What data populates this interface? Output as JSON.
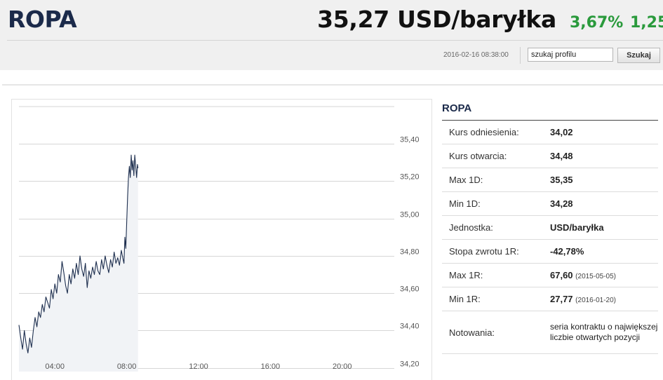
{
  "header": {
    "title": "ROPA",
    "price": "35,27 USD/baryłka",
    "change_pct": "3,67%",
    "change_abs": "1,25",
    "timestamp": "2016-02-16 08:38:00",
    "search": {
      "value": "szukaj profilu",
      "placeholder": "szukaj profilu",
      "button_label": "Szukaj"
    }
  },
  "colors": {
    "positive": "#2a9a3c",
    "title": "#1b2a4a",
    "line": "#1e2f4f",
    "area": "#f1f3f6"
  },
  "info": {
    "title": "ROPA",
    "rows": [
      {
        "label": "Kurs odniesienia:",
        "value": "34,02",
        "extra": ""
      },
      {
        "label": "Kurs otwarcia:",
        "value": "34,48",
        "extra": ""
      },
      {
        "label": "Max 1D:",
        "value": "35,35",
        "extra": ""
      },
      {
        "label": "Min 1D:",
        "value": "34,28",
        "extra": ""
      },
      {
        "label": "Jednostka:",
        "value": "USD/baryłka",
        "extra": ""
      },
      {
        "label": "Stopa zwrotu 1R:",
        "value": "-42,78%",
        "extra": ""
      },
      {
        "label": "Max 1R:",
        "value": "67,60",
        "extra": "(2015-05-05)"
      },
      {
        "label": "Min 1R:",
        "value": "27,77",
        "extra": "(2016-01-20)"
      },
      {
        "label": "Notowania:",
        "value": "seria kontraktu o największej liczbie otwartych pozycji",
        "extra": ""
      }
    ]
  },
  "chart_data": {
    "type": "area",
    "x_ticks": [
      "04:00",
      "08:00",
      "12:00",
      "16:00",
      "20:00"
    ],
    "x_tick_hours": [
      4,
      8,
      12,
      16,
      20
    ],
    "x_range_hours": [
      2,
      22.9
    ],
    "y_ticks": [
      "35,40",
      "35,20",
      "35,00",
      "34,80",
      "34,60",
      "34,40",
      "34,20"
    ],
    "y_tick_values": [
      35.4,
      35.2,
      35.0,
      34.8,
      34.6,
      34.4,
      34.2
    ],
    "ylim": [
      34.18,
      35.6
    ],
    "grid": true,
    "series": [
      {
        "x": [
          2.0,
          2.1,
          2.2,
          2.3,
          2.4,
          2.5,
          2.6,
          2.7,
          2.8,
          2.9,
          3.0,
          3.1,
          3.2,
          3.3,
          3.4,
          3.5,
          3.6,
          3.7,
          3.8,
          3.9,
          4.0,
          4.1,
          4.2,
          4.3,
          4.4,
          4.5,
          4.6,
          4.7,
          4.8,
          4.9,
          5.0,
          5.1,
          5.2,
          5.3,
          5.4,
          5.5,
          5.6,
          5.7,
          5.8,
          5.9,
          6.0,
          6.1,
          6.2,
          6.3,
          6.4,
          6.5,
          6.6,
          6.7,
          6.8,
          6.9,
          7.0,
          7.1,
          7.2,
          7.3,
          7.4,
          7.5,
          7.6,
          7.7,
          7.8,
          7.85,
          7.9,
          7.95,
          8.0,
          8.05,
          8.1,
          8.15,
          8.2,
          8.25,
          8.3,
          8.35,
          8.4,
          8.45,
          8.5,
          8.55,
          8.6,
          8.63
        ],
        "values": [
          34.43,
          34.36,
          34.3,
          34.4,
          34.33,
          34.28,
          34.36,
          34.31,
          34.4,
          34.47,
          34.42,
          34.5,
          34.47,
          34.54,
          34.5,
          34.58,
          34.55,
          34.52,
          34.62,
          34.57,
          34.65,
          34.6,
          34.7,
          34.66,
          34.77,
          34.71,
          34.64,
          34.6,
          34.7,
          34.65,
          34.73,
          34.68,
          34.76,
          34.7,
          34.8,
          34.73,
          34.69,
          34.76,
          34.63,
          34.72,
          34.68,
          34.74,
          34.7,
          34.77,
          34.72,
          34.7,
          34.78,
          34.73,
          34.8,
          34.75,
          34.71,
          34.78,
          34.74,
          34.82,
          34.76,
          34.79,
          34.75,
          34.83,
          34.78,
          34.76,
          34.9,
          34.84,
          34.98,
          35.12,
          35.22,
          35.28,
          35.22,
          35.34,
          35.26,
          35.31,
          35.23,
          35.34,
          35.28,
          35.22,
          35.29,
          35.27
        ]
      }
    ]
  }
}
